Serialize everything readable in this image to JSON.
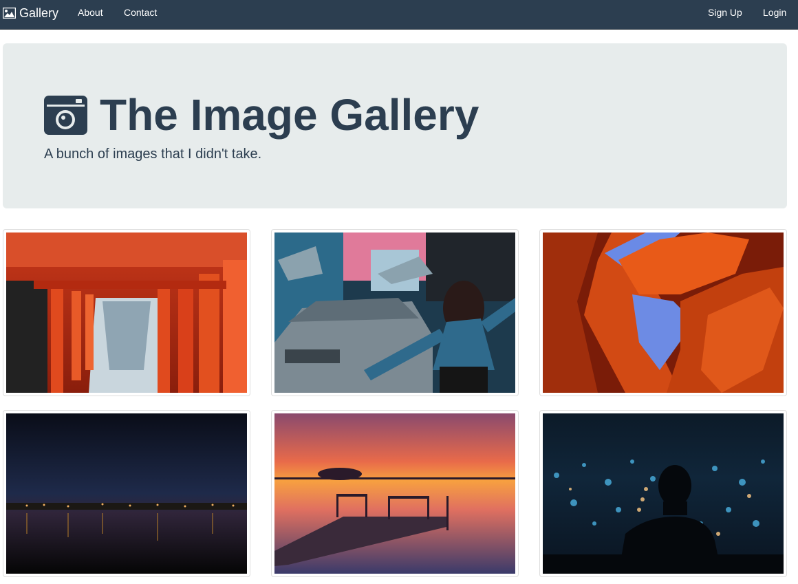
{
  "navbar": {
    "brand": {
      "label": "Gallery",
      "icon": "image-icon"
    },
    "links": [
      {
        "label": "About"
      },
      {
        "label": "Contact"
      }
    ],
    "right_links": [
      {
        "label": "Sign Up"
      },
      {
        "label": "Login"
      }
    ],
    "bg_color": "#2c3e50"
  },
  "jumbotron": {
    "title": "The Image Gallery",
    "subtitle": "A bunch of images that I didn't take.",
    "icon": "camera-icon",
    "bg_color": "#e7ecec"
  },
  "gallery": {
    "images": [
      {
        "name": "torii-gates-photo"
      },
      {
        "name": "delorean-woman-photo"
      },
      {
        "name": "canyon-rock-photo"
      },
      {
        "name": "night-city-river-photo"
      },
      {
        "name": "sunset-dock-photo"
      },
      {
        "name": "city-bokeh-silhouette-photo"
      }
    ]
  }
}
